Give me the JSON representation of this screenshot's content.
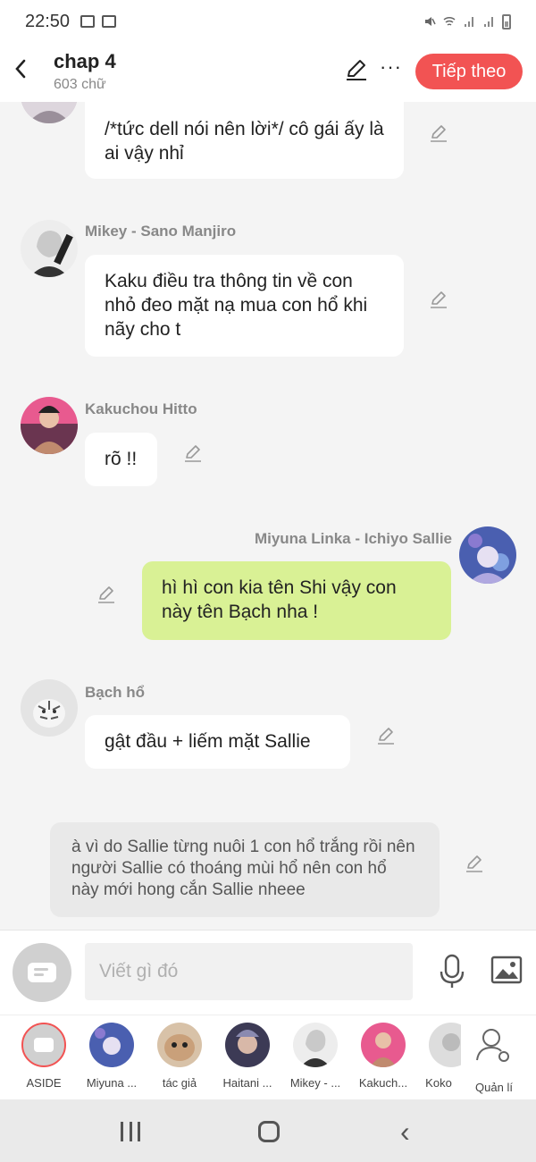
{
  "status_bar": {
    "time": "22:50"
  },
  "header": {
    "back_icon": "chevron-left-icon",
    "title": "chap 4",
    "subtitle": "603 chữ",
    "next_label": "Tiếp theo"
  },
  "messages": [
    {
      "name": "",
      "text": "/*tức dell nói nên lời*/ cô gái ấy là ai vậy nhỉ"
    },
    {
      "name": "Mikey - Sano Manjiro",
      "text": "Kaku điều tra thông tin về con nhỏ đeo mặt nạ mua con hổ khi nãy cho t"
    },
    {
      "name": "Kakuchou Hitto",
      "text": "rõ !!"
    },
    {
      "name": "Miyuna Linka - Ichiyo Sallie",
      "text": "hì hì con kia tên Shi vậy con này tên Bạch nha !"
    },
    {
      "name": "Bạch hổ",
      "text": "gật đầu + liếm mặt Sallie"
    },
    {
      "name": "",
      "text": "à vì do Sallie từng nuôi 1 con hổ trắng rồi nên người Sallie có thoáng mùi hổ nên con hổ này mới hong cắn Sallie nheee"
    }
  ],
  "composer": {
    "placeholder": "Viết gì đó"
  },
  "characters": [
    {
      "label": "ASIDE"
    },
    {
      "label": "Miyuna ..."
    },
    {
      "label": "tác giả"
    },
    {
      "label": "Haitani ..."
    },
    {
      "label": "Mikey - ..."
    },
    {
      "label": "Kakuch..."
    },
    {
      "label": "Koko"
    },
    {
      "label": "Quản lí"
    }
  ],
  "colors": {
    "accent": "#f25353",
    "my_bubble": "#d9f195"
  }
}
